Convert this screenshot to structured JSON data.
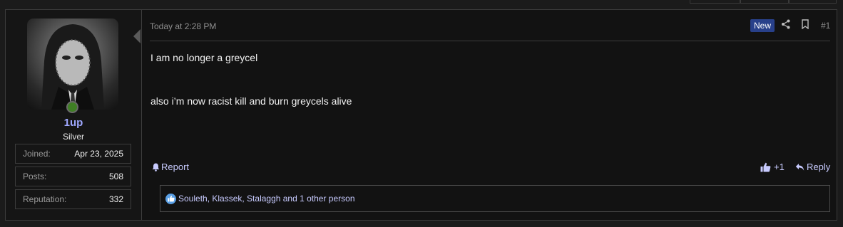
{
  "post": {
    "timestamp": "Today at 2:28 PM",
    "new_badge": "New",
    "post_number": "#1",
    "paragraphs": [
      "I am no longer a greycel",
      "also i’m now racist kill and burn greycels alive"
    ],
    "actions": {
      "report_label": "Report",
      "like_count": "+1",
      "reply_label": "Reply"
    },
    "reactions_text": "Souleth, Klassek, Stalaggh and 1 other person"
  },
  "user": {
    "username": "1up",
    "rank": "Silver",
    "online": true,
    "stats": [
      {
        "label": "Joined:",
        "value": "Apr 23, 2025"
      },
      {
        "label": "Posts:",
        "value": "508"
      },
      {
        "label": "Reputation:",
        "value": "332"
      }
    ]
  },
  "colors": {
    "accent": "#9fa8ff",
    "new_badge": "#28408a",
    "online": "#3f7f24",
    "background": "#121212"
  },
  "icons": [
    "share-icon",
    "bookmark-icon",
    "bell-icon",
    "thumbs-up-icon",
    "reply-icon",
    "like-reaction-icon"
  ]
}
